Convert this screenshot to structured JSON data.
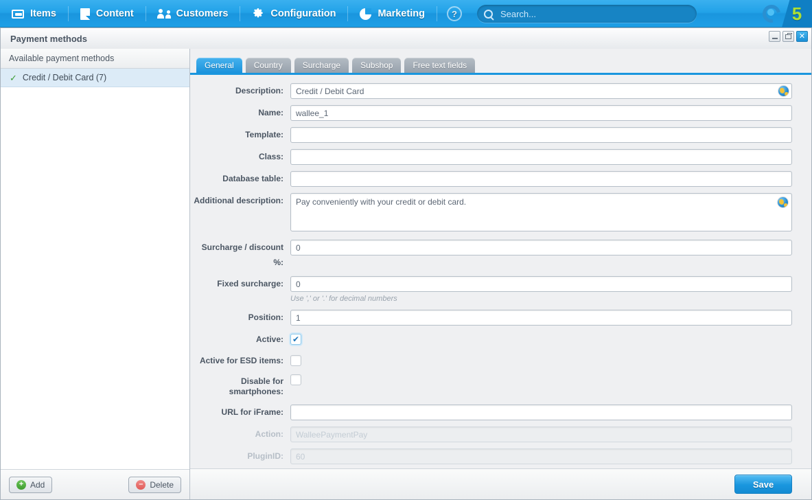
{
  "topnav": {
    "items": [
      {
        "label": "Items",
        "icon": "tray-icon"
      },
      {
        "label": "Content",
        "icon": "document-icon"
      },
      {
        "label": "Customers",
        "icon": "users-icon"
      },
      {
        "label": "Configuration",
        "icon": "gear-icon"
      },
      {
        "label": "Marketing",
        "icon": "pie-chart-icon"
      }
    ],
    "help_label": "?",
    "search": {
      "value": "",
      "placeholder": "Search..."
    },
    "brand": {
      "logo_text": "5"
    }
  },
  "window": {
    "title": "Payment methods",
    "controls": {
      "minimize": "–",
      "maximize": "□",
      "close": "✕"
    }
  },
  "left_panel": {
    "header": "Available payment methods",
    "items": [
      {
        "label": "Credit / Debit Card (7)",
        "checked": true
      }
    ],
    "add_label": "Add",
    "delete_label": "Delete",
    "add_icon_glyph": "+",
    "delete_icon_glyph": "–"
  },
  "tabs": [
    {
      "label": "General",
      "active": true
    },
    {
      "label": "Country",
      "active": false
    },
    {
      "label": "Surcharge",
      "active": false
    },
    {
      "label": "Subshop",
      "active": false
    },
    {
      "label": "Free text fields",
      "active": false
    }
  ],
  "form": {
    "description": {
      "label": "Description:",
      "value": "Credit / Debit Card"
    },
    "name": {
      "label": "Name:",
      "value": "wallee_1"
    },
    "template": {
      "label": "Template:",
      "value": ""
    },
    "class": {
      "label": "Class:",
      "value": ""
    },
    "database_table": {
      "label": "Database table:",
      "value": ""
    },
    "additional_description": {
      "label": "Additional description:",
      "value": "Pay conveniently with your credit or debit card."
    },
    "surcharge_discount": {
      "label": "Surcharge / discount %:",
      "value": "0"
    },
    "fixed_surcharge": {
      "label": "Fixed surcharge:",
      "value": "0",
      "hint": "Use ',' or '.' for decimal numbers"
    },
    "position": {
      "label": "Position:",
      "value": "1"
    },
    "active": {
      "label": "Active:",
      "checked": true,
      "tick": "✔"
    },
    "active_esd": {
      "label": "Active for ESD items:",
      "checked": false
    },
    "disable_smartphones": {
      "label": "Disable for smartphones:",
      "checked": false
    },
    "url_iframe": {
      "label": "URL for iFrame:",
      "value": ""
    },
    "action": {
      "label": "Action:",
      "value": "WalleePaymentPay",
      "disabled": true
    },
    "plugin_id": {
      "label": "PluginID:",
      "value": "60",
      "disabled": true
    }
  },
  "footer": {
    "save_label": "Save"
  },
  "colors": {
    "accent": "#1a96de",
    "brand_green": "#aee033",
    "form_bg": "#eff0f2",
    "check_green": "#3c9c34"
  }
}
